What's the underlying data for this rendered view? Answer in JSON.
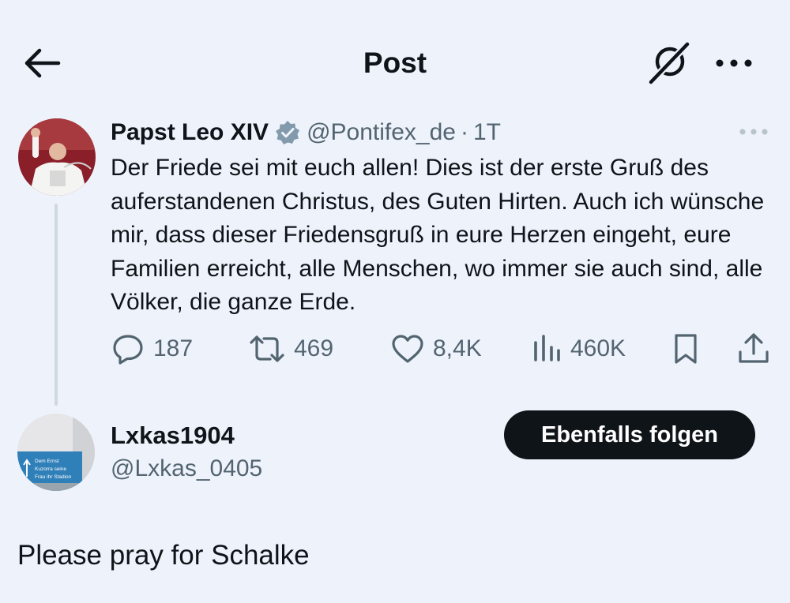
{
  "header": {
    "title": "Post",
    "back_icon": "arrow-left-icon",
    "grok_icon": "grok-icon",
    "more_icon": "more-horizontal-icon"
  },
  "post": {
    "author_name": "Papst Leo XIV",
    "verified": true,
    "handle": "@Pontifex_de",
    "separator": "·",
    "time": "1T",
    "text": "Der Friede sei mit euch allen! Dies ist der erste Gruß des auferstandenen Christus, des Guten Hirten. Auch ich wünsche mir, dass dieser Friedensgruß in eure Herzen eingeht, eure Familien erreicht, alle Menschen, wo immer sie auch sind, alle Völker, die ganze Erde.",
    "stats": {
      "replies": "187",
      "reposts": "469",
      "likes": "8,4K",
      "views": "460K"
    }
  },
  "reply_user": {
    "name": "Lxkas1904",
    "handle": "@Lxkas_0405",
    "follow_label": "Ebenfalls folgen",
    "avatar_sign_lines": [
      "Dem Ernst",
      "Kuzorra seine",
      "Frau ihr Stadion"
    ]
  },
  "reply": {
    "text": "Please pray for Schalke"
  },
  "colors": {
    "background": "#eef3fb",
    "text": "#0f1419",
    "secondary": "#536471",
    "verified_badge": "#829aab",
    "follow_button_bg": "#0f1419"
  }
}
